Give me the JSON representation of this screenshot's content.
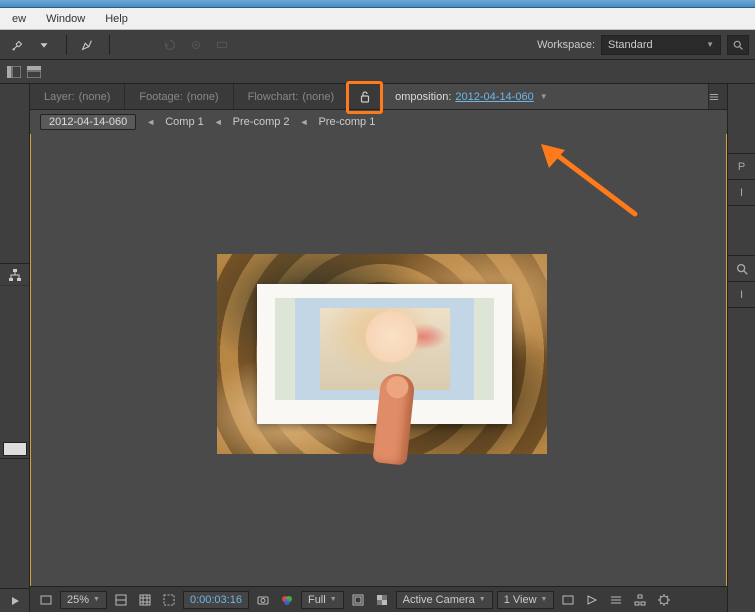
{
  "menu": {
    "view": "ew",
    "window": "Window",
    "help": "Help"
  },
  "workspace": {
    "label": "Workspace:",
    "value": "Standard"
  },
  "viewer_tabs": {
    "layer": {
      "prefix": "Layer:",
      "value": "(none)"
    },
    "footage": {
      "prefix": "Footage:",
      "value": "(none)"
    },
    "flowchart": {
      "prefix": "Flowchart:",
      "value": "(none)"
    },
    "composition": {
      "prefix": "omposition:",
      "value": "2012-04-14-060"
    }
  },
  "breadcrumbs": {
    "root": "2012-04-14-060",
    "c1": "Comp 1",
    "c2": "Pre-comp 2",
    "c3": "Pre-comp 1"
  },
  "statusbar": {
    "zoom": "25%",
    "resolution": "Full",
    "timecode": "0:00:03:16",
    "camera": "Active Camera",
    "views": "1 View"
  },
  "right_panels": {
    "p1": "P",
    "p2": "I",
    "p3": "I"
  },
  "colors": {
    "accent_orange": "#ff7a1a",
    "frame_gold": "#d4a23a"
  }
}
